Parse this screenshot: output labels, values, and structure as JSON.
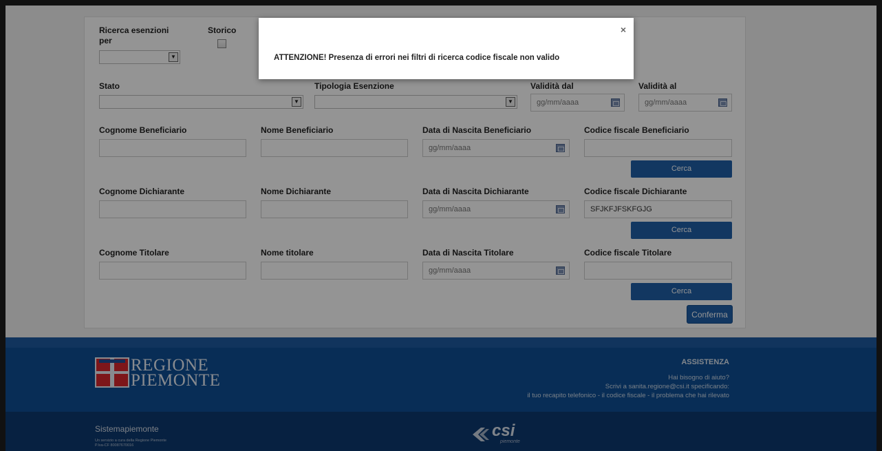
{
  "form": {
    "ricerca_label": "Ricerca esenzioni per",
    "storico_label": "Storico",
    "stato_label": "Stato",
    "tipologia_label": "Tipologia Esenzione",
    "validita_dal_label": "Validità dal",
    "validita_al_label": "Validità al",
    "date_placeholder": "gg/mm/aaaa",
    "beneficiario": {
      "cognome_label": "Cognome Beneficiario",
      "nome_label": "Nome Beneficiario",
      "nascita_label": "Data di Nascita Beneficiario",
      "cf_label": "Codice fiscale Beneficiario",
      "cf_value": ""
    },
    "dichiarante": {
      "cognome_label": "Cognome Dichiarante",
      "nome_label": "Nome Dichiarante",
      "nascita_label": "Data di Nascita Dichiarante",
      "cf_label": "Codice fiscale Dichiarante",
      "cf_value": "SFJKFJFSKFGJG"
    },
    "titolare": {
      "cognome_label": "Cognome Titolare",
      "nome_label": "Nome titolare",
      "nascita_label": "Data di Nascita Titolare",
      "cf_label": "Codice fiscale Titolare",
      "cf_value": ""
    },
    "cerca_label": "Cerca",
    "conferma_label": "Conferma"
  },
  "modal": {
    "close": "×",
    "message": "ATTENZIONE! Presenza di errori nei filtri di ricerca codice fiscale non valido"
  },
  "footer": {
    "logo_line1": "REGIONE",
    "logo_line2": "PIEMONTE",
    "assist_title": "ASSISTENZA",
    "assist_q": "Hai bisogno di aiuto?",
    "assist_write": "Scrivi a sanita.regione@csi.it specificando:",
    "assist_items": "il tuo recapito telefonico - il codice fiscale - il problema che hai rilevato",
    "sp_title": "Sistemapiemonte",
    "sp_sub1": "Un servizio a cura della Regione Piemonte",
    "sp_sub2": "P.Iva-CF 80087670016",
    "csi_text": "csi",
    "csi_sub": "piemonte"
  },
  "colors": {
    "primary_button": "#1f5fa8",
    "footer_top": "#0f4f95",
    "footer_bottom": "#0d3970"
  }
}
